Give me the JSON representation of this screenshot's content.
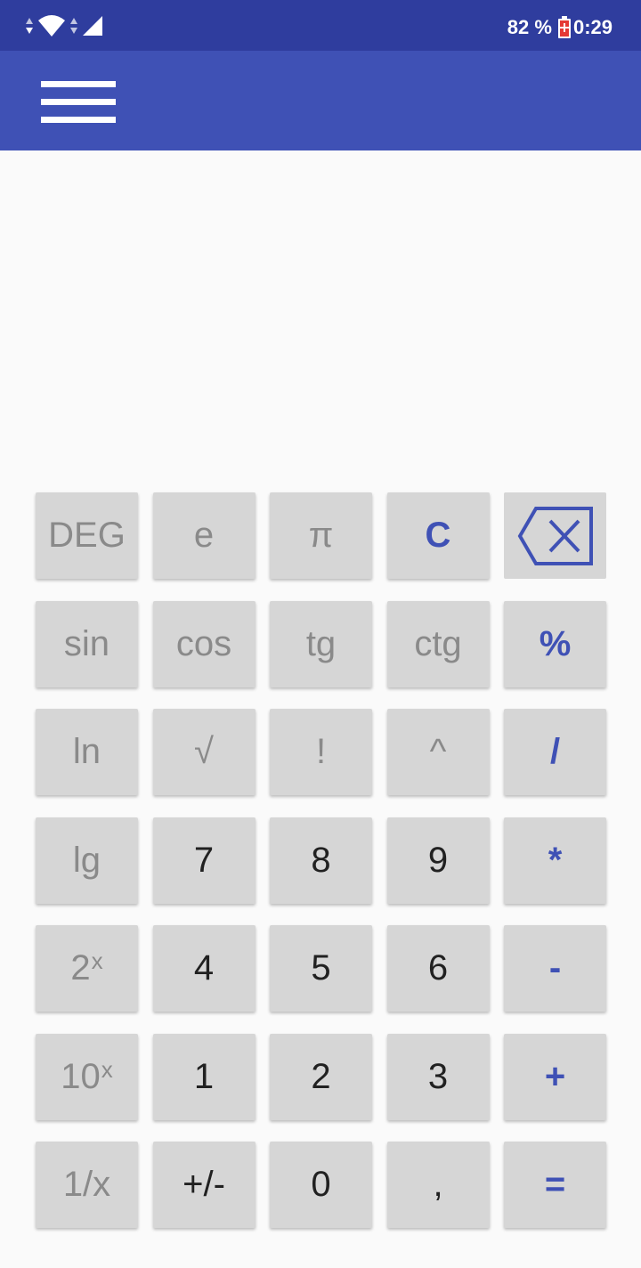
{
  "status_bar": {
    "battery_percent": "82 %",
    "time": "0:29"
  },
  "app_bar": {
    "menu_icon": "hamburger-menu-icon"
  },
  "display": {
    "expression": "",
    "result": ""
  },
  "keypad": {
    "rows": [
      [
        {
          "id": "deg",
          "label": "DEG",
          "kind": "fn"
        },
        {
          "id": "e",
          "label": "e",
          "kind": "fn"
        },
        {
          "id": "pi",
          "label": "π",
          "kind": "fn"
        },
        {
          "id": "clear",
          "label": "C",
          "kind": "op"
        },
        {
          "id": "backspace",
          "label": "",
          "kind": "back",
          "icon": "backspace-icon"
        }
      ],
      [
        {
          "id": "sin",
          "label": "sin",
          "kind": "fn"
        },
        {
          "id": "cos",
          "label": "cos",
          "kind": "fn"
        },
        {
          "id": "tg",
          "label": "tg",
          "kind": "fn"
        },
        {
          "id": "ctg",
          "label": "ctg",
          "kind": "fn"
        },
        {
          "id": "percent",
          "label": "%",
          "kind": "op"
        }
      ],
      [
        {
          "id": "ln",
          "label": "ln",
          "kind": "fn"
        },
        {
          "id": "sqrt",
          "label": "√",
          "kind": "fn"
        },
        {
          "id": "factorial",
          "label": "!",
          "kind": "fn"
        },
        {
          "id": "power",
          "label": "^",
          "kind": "fn"
        },
        {
          "id": "divide",
          "label": "/",
          "kind": "op"
        }
      ],
      [
        {
          "id": "lg",
          "label": "lg",
          "kind": "fn"
        },
        {
          "id": "seven",
          "label": "7",
          "kind": "num"
        },
        {
          "id": "eight",
          "label": "8",
          "kind": "num"
        },
        {
          "id": "nine",
          "label": "9",
          "kind": "num"
        },
        {
          "id": "multiply",
          "label": "*",
          "kind": "op"
        }
      ],
      [
        {
          "id": "two-pow-x",
          "label": "2",
          "sup": "x",
          "kind": "fn"
        },
        {
          "id": "four",
          "label": "4",
          "kind": "num"
        },
        {
          "id": "five",
          "label": "5",
          "kind": "num"
        },
        {
          "id": "six",
          "label": "6",
          "kind": "num"
        },
        {
          "id": "minus",
          "label": "-",
          "kind": "op"
        }
      ],
      [
        {
          "id": "ten-pow-x",
          "label": "10",
          "sup": "x",
          "kind": "fn"
        },
        {
          "id": "one",
          "label": "1",
          "kind": "num"
        },
        {
          "id": "two",
          "label": "2",
          "kind": "num"
        },
        {
          "id": "three",
          "label": "3",
          "kind": "num"
        },
        {
          "id": "plus",
          "label": "+",
          "kind": "op"
        }
      ],
      [
        {
          "id": "reciprocal",
          "label": "1/x",
          "kind": "fn"
        },
        {
          "id": "negate",
          "label": "+/-",
          "kind": "num"
        },
        {
          "id": "zero",
          "label": "0",
          "kind": "num"
        },
        {
          "id": "comma",
          "label": ",",
          "kind": "num"
        },
        {
          "id": "equals",
          "label": "=",
          "kind": "op"
        }
      ]
    ]
  },
  "colors": {
    "status_bar": "#2f3d9e",
    "app_bar": "#3f51b5",
    "accent": "#3f51b5",
    "key_background": "#d6d6d6",
    "function_text": "#8a8a8a",
    "number_text": "#212121"
  }
}
